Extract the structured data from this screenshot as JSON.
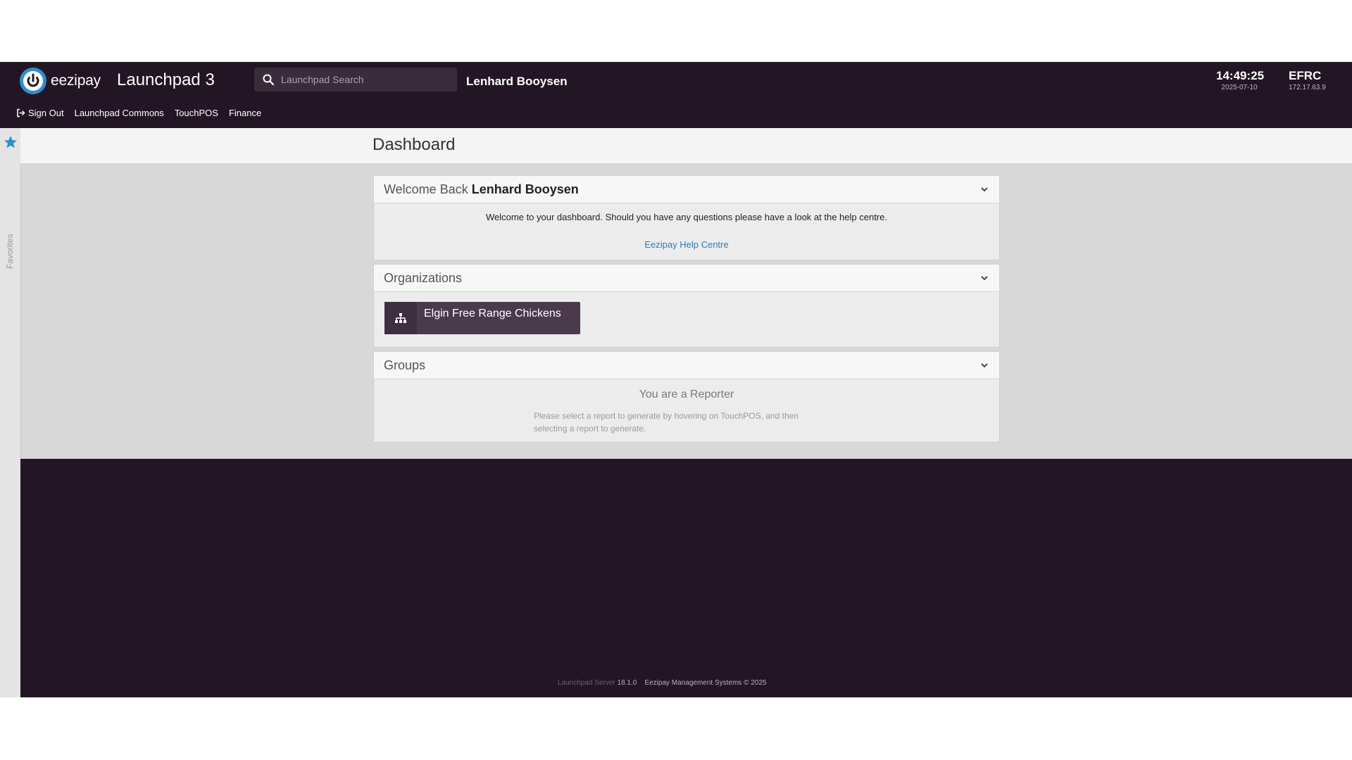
{
  "header": {
    "brand_name": "eezipay",
    "app_title": "Launchpad 3",
    "search_placeholder": "Launchpad Search",
    "username": "Lenhard Booysen",
    "time": "14:49:25",
    "date": "2025-07-10",
    "site_code": "EFRC",
    "ip_address": "172.17.63.9"
  },
  "nav": {
    "sign_out": "Sign Out",
    "items": [
      "Launchpad Commons",
      "TouchPOS",
      "Finance"
    ]
  },
  "sidebar": {
    "favorites_label": "Favorites",
    "accent": "#2b8fd0"
  },
  "page": {
    "title": "Dashboard"
  },
  "welcome_panel": {
    "prefix": "Welcome Back",
    "name": "Lenhard Booysen",
    "message": "Welcome to your dashboard. Should you have any questions please have a look at the help centre.",
    "help_link": "Eezipay Help Centre"
  },
  "organizations_panel": {
    "title": "Organizations",
    "org_button": "Elgin Free Range Chickens"
  },
  "groups_panel": {
    "title": "Groups",
    "role": "You are a Reporter",
    "help_line_1": "Please select a report to generate by hovering on TouchPOS, and then",
    "help_line_2": "selecting a report to generate."
  },
  "footer": {
    "server_label": "Launchpad Server",
    "version": "18.1.0",
    "copyright": "Eezipay Management Systems © 2025"
  },
  "annotation": {
    "arrow_color": "#f58a3c"
  }
}
